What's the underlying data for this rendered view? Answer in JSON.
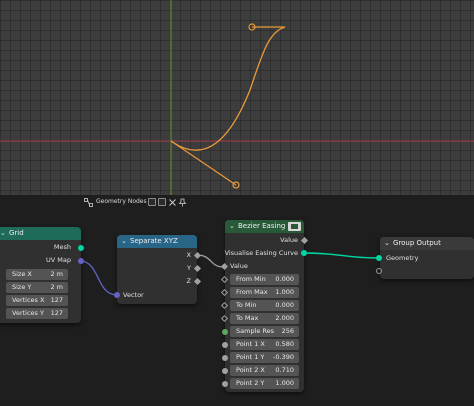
{
  "viewport": {
    "colors": {
      "curve": "#e89a3c",
      "x_axis": "#a8434b",
      "y_axis": "#6a9a2f"
    }
  },
  "editor": {
    "title": "Geometry Nodes",
    "icons": [
      "node-tree-icon",
      "new-icon",
      "copy-icon",
      "delete-icon",
      "pin-icon"
    ]
  },
  "nodes": {
    "grid": {
      "title": "Grid",
      "header_color": "#1e6b5a",
      "outputs": [
        "Mesh",
        "UV Map"
      ],
      "fields": [
        {
          "label": "Size X",
          "value": "2 m"
        },
        {
          "label": "Size Y",
          "value": "2 m"
        },
        {
          "label": "Vertices X",
          "value": "127"
        },
        {
          "label": "Vertices Y",
          "value": "127"
        }
      ]
    },
    "separate_xyz": {
      "title": "Separate XYZ",
      "header_color": "#286587",
      "outputs": [
        "X",
        "Y",
        "Z"
      ],
      "input": "Vector"
    },
    "bezier_easing": {
      "title": "Bezier Easing",
      "header_color": "#285a39",
      "outputs": [
        "Value",
        "Visualise Easing Curve"
      ],
      "input": "Value",
      "fields": [
        {
          "label": "From Min",
          "value": "0.000"
        },
        {
          "label": "From Max",
          "value": "1.000"
        },
        {
          "label": "To Min",
          "value": "0.000"
        },
        {
          "label": "To Max",
          "value": "2.000"
        },
        {
          "label": "Sample Res",
          "value": "256"
        },
        {
          "label": "Point 1 X",
          "value": "0.580"
        },
        {
          "label": "Point 1 Y",
          "value": "-0.390"
        },
        {
          "label": "Point 2 X",
          "value": "0.710"
        },
        {
          "label": "Point 2 Y",
          "value": "1.000"
        }
      ]
    },
    "group_output": {
      "title": "Group Output",
      "header_color": "#3a3a3a",
      "inputs": [
        "Geometry"
      ]
    }
  },
  "links": {
    "teal": "#00d6a3",
    "purple": "#6363c7",
    "grey": "#a1a1a1"
  }
}
